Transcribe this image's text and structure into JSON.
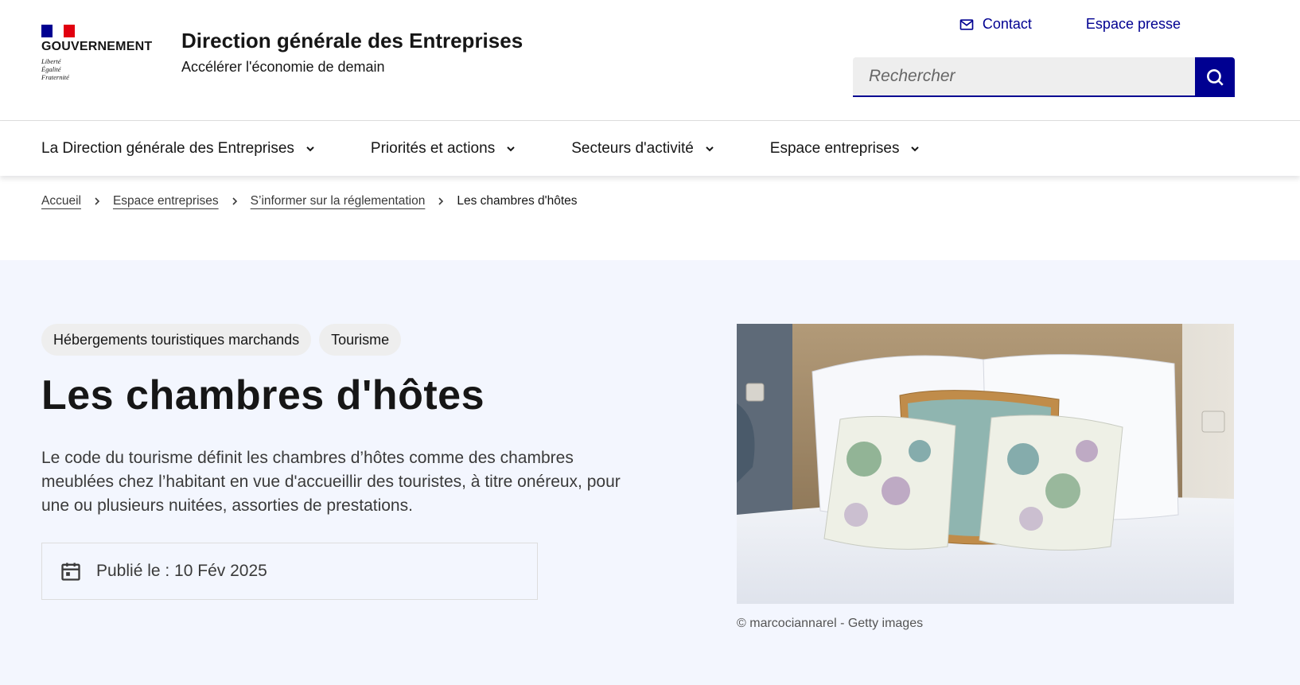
{
  "header": {
    "logo": {
      "gouv": "GOUVERNEMENT",
      "devise": [
        "Liberté",
        "Égalité",
        "Fraternité"
      ],
      "flag_colors": [
        "#000091",
        "#ffffff",
        "#e1000f"
      ]
    },
    "site_title": "Direction générale des Entreprises",
    "tagline": "Accélérer l'économie de demain",
    "tools": {
      "contact": "Contact",
      "presse": "Espace presse"
    },
    "search": {
      "placeholder": "Rechercher"
    }
  },
  "nav": {
    "items": [
      {
        "label": "La Direction générale des Entreprises"
      },
      {
        "label": "Priorités et actions"
      },
      {
        "label": "Secteurs d'activité"
      },
      {
        "label": "Espace entreprises"
      }
    ]
  },
  "breadcrumb": {
    "items": [
      {
        "label": "Accueil"
      },
      {
        "label": "Espace entreprises"
      },
      {
        "label": "S’informer sur la réglementation"
      }
    ],
    "current": "Les chambres d'hôtes"
  },
  "hero": {
    "tags": [
      {
        "label": "Hébergements touristiques marchands"
      },
      {
        "label": "Tourisme"
      }
    ],
    "title": "Les chambres d'hôtes",
    "description": "Le code du tourisme définit les chambres d’hôtes comme des chambres meublées chez l’habitant en vue d'accueillir des touristes, à titre onéreux, pour une ou plusieurs nuitées, assorties de prestations.",
    "published": "Publié le : 10 Fév 2025",
    "image_credit": "© marcociannarel - Getty images"
  },
  "colors": {
    "brand_blue": "#000091",
    "hero_bg": "#f3f6fe",
    "tag_bg": "#eeeeee"
  }
}
